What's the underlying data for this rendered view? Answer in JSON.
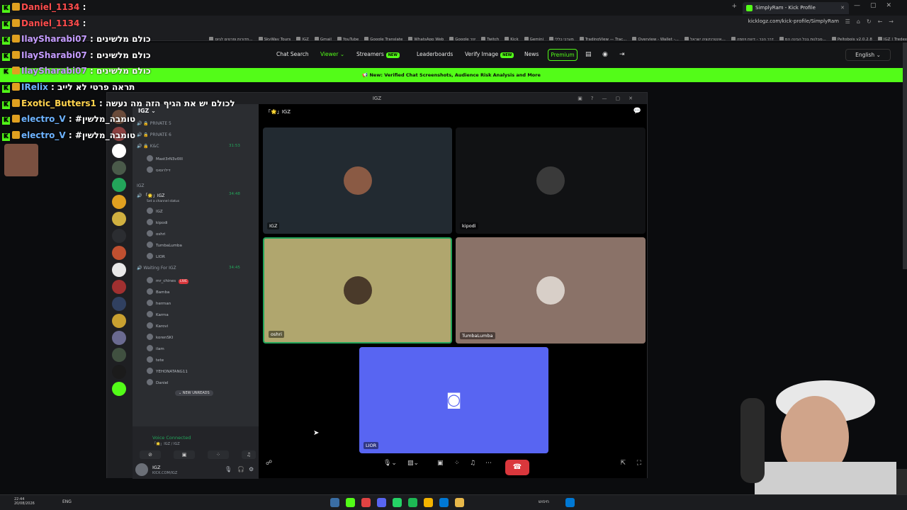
{
  "browser": {
    "tab_title": "SimplyRam - Kick Profile",
    "url": "kicklogz.com/kick-profile/SimplyRam",
    "bookmarks": [
      "IGZ | Tredex",
      "Peltobois v2.0.2.8",
      "סבלנות בכל הבינה המ...",
      "דרך הכר - דיווח ויוזמה",
      "אינטרנקציה ישראל...",
      "Overview - Wallet -...",
      "TradingView — Trac...",
      "מערכי כללי",
      "Gemini",
      "Kick",
      "Twitch",
      "Google יוזר",
      "WhatsApp Web",
      "Google Translate",
      "YouTube",
      "Gmail",
      "IGZ",
      "SkyWay Tours",
      "חדורות ופרטים לגיוס..."
    ]
  },
  "site_nav": {
    "chat_search": "Chat Search",
    "viewer": "Viewer",
    "streamers": "Streamers",
    "new_badge": "NEW",
    "leaderboards": "Leaderboards",
    "verify_image": "Verify Image",
    "news": "News",
    "premium": "Premium",
    "language": "English",
    "banner": "New: Verified Chat Screenshots, Audience Risk Analysis and More"
  },
  "discord": {
    "window_title": "IGZ",
    "server_name": "IGZ",
    "stage_header": "「🌟」IGZ",
    "channels": [
      {
        "name": "PRIVATE 5",
        "time": ""
      },
      {
        "name": "PRIVATE 6",
        "time": ""
      },
      {
        "name": "K&C",
        "time": "31:53"
      }
    ],
    "kc_users": [
      "Mast3rN3v0lll",
      "דילרוסוס"
    ],
    "category": "IGZ",
    "voice_channel": {
      "name": "「🌟」IGZ",
      "time": "34:48",
      "status": "Set a channel status"
    },
    "igz_users": [
      "IGZ",
      "kipodi",
      "oshri",
      "TumbaLumba",
      "LIOR"
    ],
    "waiting_channel": {
      "name": "Waiting For IGZ",
      "time": "34:45"
    },
    "waiting_users": [
      "mr_chines",
      "Bamba",
      "herman",
      "Karma",
      "Karovi",
      "korenSKI",
      "ilam",
      "tete",
      "YEHONATANG11",
      "Daniel"
    ],
    "live_label": "LIVE",
    "new_unreads": "NEW UNREADS",
    "voice_connected": "Voice Connected",
    "voice_sub": "「🌟」IGZ / IGZ",
    "user_name": "IGZ",
    "user_status": "KICK.COM/IGZ",
    "tiles": [
      {
        "name": "IGZ",
        "color": "#222a31"
      },
      {
        "name": "kipodi",
        "color": "#111214"
      },
      {
        "name": "oshri",
        "color": "#b0a66e"
      },
      {
        "name": "TumbaLumba",
        "color": "#8a7268"
      },
      {
        "name": "LIOR",
        "color": "#5865f2"
      }
    ]
  },
  "overlay_chat": [
    {
      "user": "Daniel_1134",
      "msg": ":",
      "color": "#ff4d4d"
    },
    {
      "user": "Daniel_1134",
      "msg": ":",
      "color": "#ff4d4d"
    },
    {
      "user": "IlaySharabi07",
      "msg": ": כולם מלשינים",
      "color": "#c59cff"
    },
    {
      "user": "IlaySharabi07",
      "msg": ": כולם מלשינים",
      "color": "#c59cff"
    },
    {
      "user": "IlaySharabi07",
      "msg": ": כולם מלשינים",
      "color": "#c59cff"
    },
    {
      "user": "IRelix",
      "msg": ": תראה פרטי לא לייב",
      "color": "#6db3ff"
    },
    {
      "user": "Exotic_Butters1",
      "msg": ": לכולם יש את הגיף הזה מה נעשה",
      "color": "#ffd34d"
    },
    {
      "user": "electro_V",
      "msg": ": #טומבה_מלשין",
      "color": "#6db3ff"
    },
    {
      "user": "electro_V",
      "msg": ": #טומבה_מלשין",
      "color": "#6db3ff"
    }
  ],
  "taskbar": {
    "time": "22:44",
    "date": "20/08/2026",
    "lang": "ENG",
    "search": "חיפוש"
  }
}
